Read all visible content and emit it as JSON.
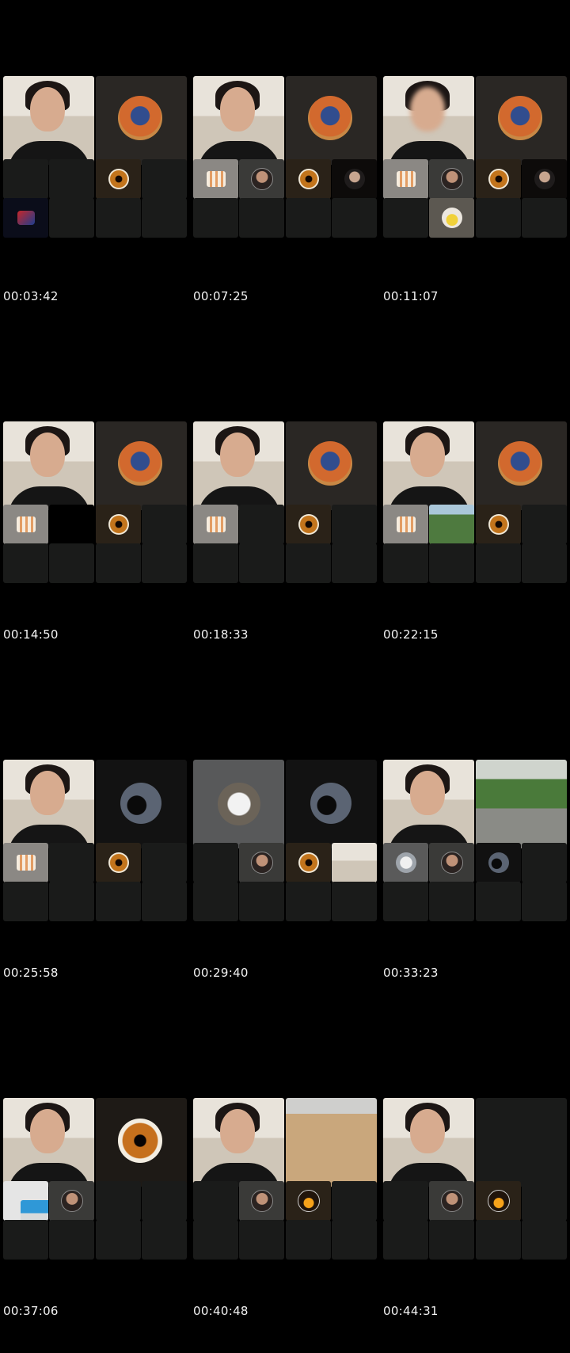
{
  "frames": [
    {
      "timestamp": "00:03:42",
      "main_left": "participant-video",
      "main_right": "mandala-avatar"
    },
    {
      "timestamp": "00:07:25",
      "main_left": "participant-video",
      "main_right": "mandala-avatar"
    },
    {
      "timestamp": "00:11:07",
      "main_left": "participant-video-blurred",
      "main_right": "mandala-avatar"
    },
    {
      "timestamp": "00:14:50",
      "main_left": "participant-video",
      "main_right": "mandala-avatar"
    },
    {
      "timestamp": "00:18:33",
      "main_left": "participant-video",
      "main_right": "mandala-avatar"
    },
    {
      "timestamp": "00:22:15",
      "main_left": "participant-video",
      "main_right": "mandala-avatar"
    },
    {
      "timestamp": "00:25:58",
      "main_left": "participant-video",
      "main_right": "silhouette-avatar"
    },
    {
      "timestamp": "00:29:40",
      "main_left": "masked-avatar",
      "main_right": "silhouette-avatar"
    },
    {
      "timestamp": "00:33:23",
      "main_left": "participant-video",
      "main_right": "road-scene-video"
    },
    {
      "timestamp": "00:37:06",
      "main_left": "participant-video",
      "main_right": "eye-avatar"
    },
    {
      "timestamp": "00:40:48",
      "main_left": "participant-video",
      "main_right": "desk-video"
    },
    {
      "timestamp": "00:44:31",
      "main_left": "participant-video",
      "main_right": "empty-tile"
    }
  ],
  "colors": {
    "background": "#000000",
    "tile": "#1a1b1a",
    "timestamp_text": "#f2f2f2"
  }
}
